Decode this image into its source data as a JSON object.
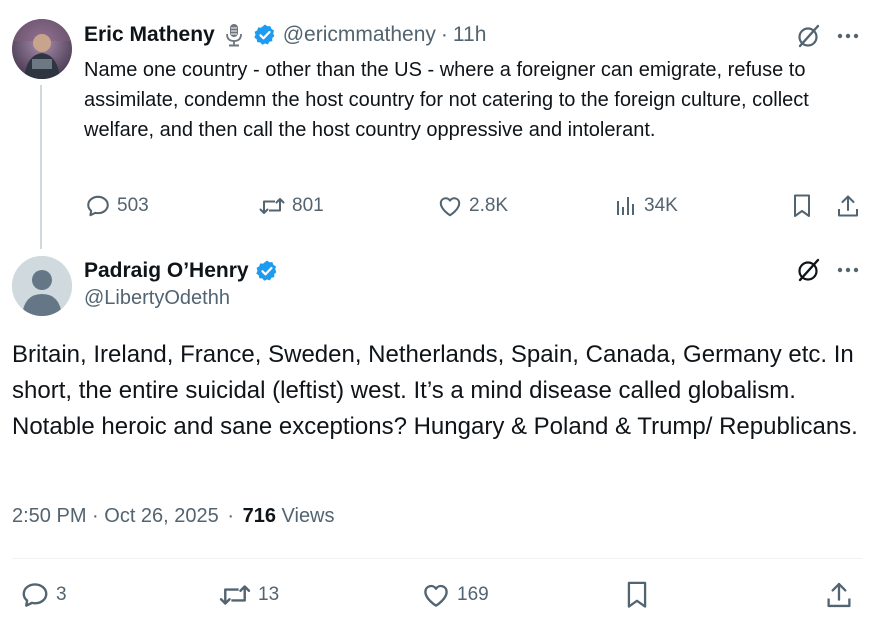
{
  "parent_tweet": {
    "author_name": "Eric Matheny",
    "handle": "@ericmmatheny",
    "separator": "·",
    "time_ago": "11h",
    "text": "Name one country - other than the US - where a foreigner can emigrate, refuse to assimilate, condemn the host country for not catering to the foreign culture, collect welfare, and then call the host country oppressive and intolerant.",
    "stats": {
      "replies": "503",
      "reposts": "801",
      "likes": "2.8K",
      "views": "34K"
    }
  },
  "reply_tweet": {
    "author_name": "Padraig O’Henry",
    "handle": "@LibertyOdethh",
    "text": "Britain, Ireland, France, Sweden, Netherlands, Spain, Canada, Germany etc.  In short, the entire suicidal (leftist) west.  It’s a mind disease called globalism.  Notable heroic and sane exceptions?  Hungary & Poland & Trump/ Republicans.",
    "timestamp": "2:50 PM · Oct 26, 2025",
    "meta_separator": "·",
    "views_count": "716",
    "views_label": "Views",
    "stats": {
      "replies": "3",
      "reposts": "13",
      "likes": "169"
    }
  },
  "colors": {
    "verified_blue": "#1d9bf0",
    "secondary_text": "#536471",
    "primary_text": "#0f1419",
    "thread_line": "#cfd9de"
  },
  "icons": [
    "microphone-icon",
    "verified-badge-icon",
    "grok-icon",
    "more-icon",
    "reply-icon",
    "repost-icon",
    "like-icon",
    "views-icon",
    "bookmark-icon",
    "share-icon"
  ]
}
